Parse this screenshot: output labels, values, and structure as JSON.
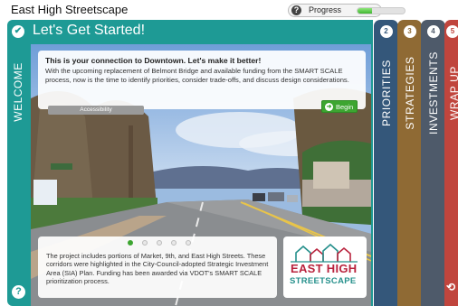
{
  "app": {
    "title": "East High Streetscape"
  },
  "progress": {
    "label": "Progress",
    "help_icon": "question-icon",
    "value_fraction": 0.3,
    "accent": "#3fb631"
  },
  "welcome": {
    "side_label": "WELCOME",
    "title": "Let's Get Started!",
    "check_icon": "check-icon",
    "help_icon": "question-icon",
    "accent": "#1e9a95",
    "intro": {
      "heading": "This is your connection to Downtown. Let's make it better!",
      "body": "With the upcoming replacement of Belmont Bridge and available funding from the SMART SCALE process, now is the time to identify priorities, consider trade-offs, and discuss design considerations."
    },
    "begin_label": "Begin",
    "accessibility_label": "Accessibility",
    "slides": {
      "count": 5,
      "active_index": 0
    },
    "info_text": "The project includes portions of Market, 9th, and East High Streets. These corridors were highlighted in the City-Council-adopted Strategic Investment Area (SIA) Plan. Funding has been awarded via VDOT's SMART SCALE prioritization process.",
    "logo": {
      "line1": "EAST HIGH",
      "line2": "STREETSCAPE"
    }
  },
  "tabs": [
    {
      "number": "2",
      "label": "PRIORITIES",
      "color": "#34577a"
    },
    {
      "number": "3",
      "label": "STRATEGIES",
      "color": "#8f6a34"
    },
    {
      "number": "4",
      "label": "INVESTMENTS",
      "color": "#4e5a6a"
    },
    {
      "number": "5",
      "label": "WRAP UP",
      "color": "#c0453d"
    }
  ],
  "refresh_icon": "refresh-icon"
}
